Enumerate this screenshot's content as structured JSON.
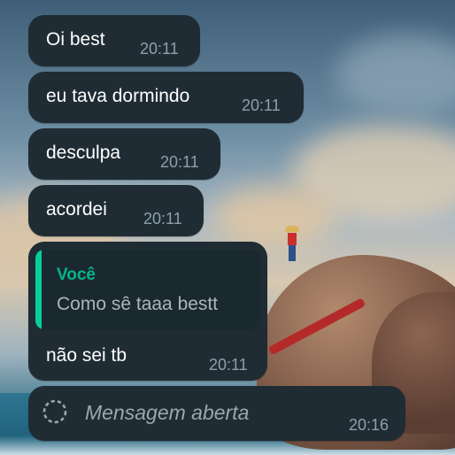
{
  "messages": [
    {
      "text": "Oi best",
      "time": "20:11"
    },
    {
      "text": "eu tava dormindo",
      "time": "20:11"
    },
    {
      "text": "desculpa",
      "time": "20:11"
    },
    {
      "text": "acordei",
      "time": "20:11"
    },
    {
      "reply": {
        "author": "Você",
        "text": "Como sê taaa bestt"
      },
      "text": "não sei tb",
      "time": "20:11"
    },
    {
      "status_text": "Mensagem aberta",
      "time": "20:16",
      "icon": "view-once-opened-icon"
    }
  ],
  "colors": {
    "bubble": "#1f2c34",
    "quote_background": "#1a2930",
    "quote_accent": "#06cf9c",
    "time_text": "#8ea0aa"
  }
}
